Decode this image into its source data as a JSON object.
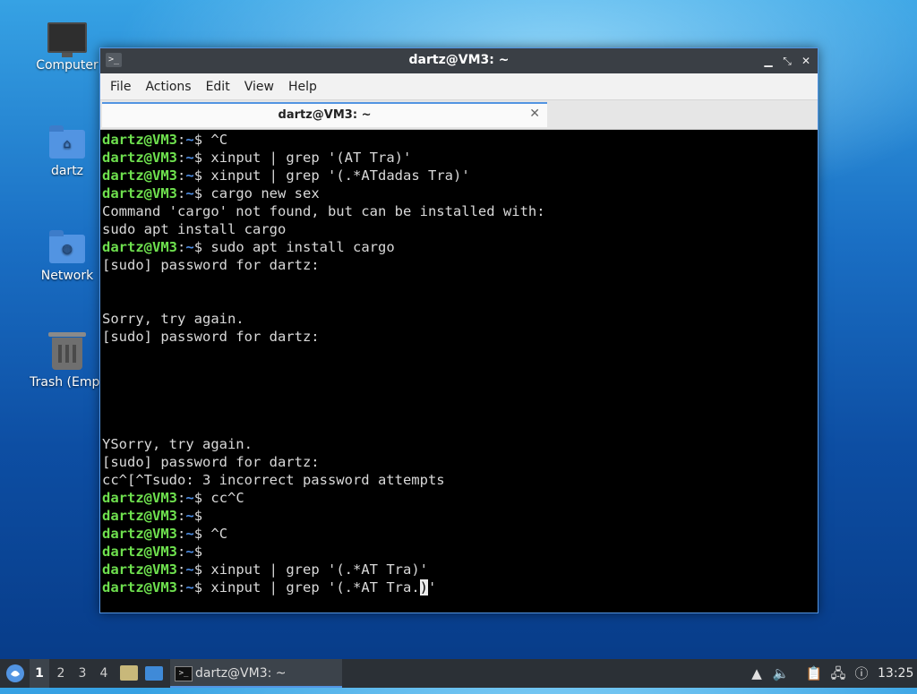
{
  "desktop": {
    "icons": [
      {
        "label": "Computer",
        "icon": "computer-icon"
      },
      {
        "label": "dartz",
        "icon": "home-folder-icon"
      },
      {
        "label": "Network",
        "icon": "network-folder-icon"
      },
      {
        "label": "Trash (Empt",
        "icon": "trash-icon"
      }
    ]
  },
  "window": {
    "title": "dartz@VM3: ~",
    "menu": [
      "File",
      "Actions",
      "Edit",
      "View",
      "Help"
    ],
    "tab_label": "dartz@VM3: ~",
    "prompt_user": "dartz@VM3",
    "prompt_sep": ":",
    "prompt_path": "~",
    "prompt_dollar": "$ ",
    "lines": [
      {
        "prompt": true,
        "text": "^C"
      },
      {
        "prompt": true,
        "text": "xinput | grep '(AT Tra)'"
      },
      {
        "prompt": true,
        "text": "xinput | grep '(.*ATdadas Tra)'"
      },
      {
        "prompt": true,
        "text": "cargo new sex"
      },
      {
        "prompt": false,
        "text": "Command 'cargo' not found, but can be installed with:"
      },
      {
        "prompt": false,
        "text": "sudo apt install cargo"
      },
      {
        "prompt": true,
        "text": "sudo apt install cargo"
      },
      {
        "prompt": false,
        "text": "[sudo] password for dartz:"
      },
      {
        "prompt": false,
        "text": ""
      },
      {
        "prompt": false,
        "text": ""
      },
      {
        "prompt": false,
        "text": "Sorry, try again."
      },
      {
        "prompt": false,
        "text": "[sudo] password for dartz:"
      },
      {
        "prompt": false,
        "text": ""
      },
      {
        "prompt": false,
        "text": ""
      },
      {
        "prompt": false,
        "text": ""
      },
      {
        "prompt": false,
        "text": ""
      },
      {
        "prompt": false,
        "text": ""
      },
      {
        "prompt": false,
        "text": "YSorry, try again."
      },
      {
        "prompt": false,
        "text": "[sudo] password for dartz:"
      },
      {
        "prompt": false,
        "text": "cc^[^Tsudo: 3 incorrect password attempts"
      },
      {
        "prompt": true,
        "text": "cc^C"
      },
      {
        "prompt": true,
        "text": ""
      },
      {
        "prompt": true,
        "text": "^C"
      },
      {
        "prompt": true,
        "text": ""
      },
      {
        "prompt": true,
        "text": "xinput | grep '(.*AT Tra)'"
      },
      {
        "prompt": true,
        "text": "xinput | grep '(.*AT Tra.",
        "cursor": ")",
        "after": "'"
      }
    ]
  },
  "taskbar": {
    "workspaces": [
      "1",
      "2",
      "3",
      "4"
    ],
    "active_workspace": "1",
    "task_label": "dartz@VM3: ~",
    "clock": "13:25"
  },
  "colors": {
    "accent": "#5294e2",
    "prompt_user": "#6ee04e",
    "prompt_path": "#4f8fe6"
  }
}
